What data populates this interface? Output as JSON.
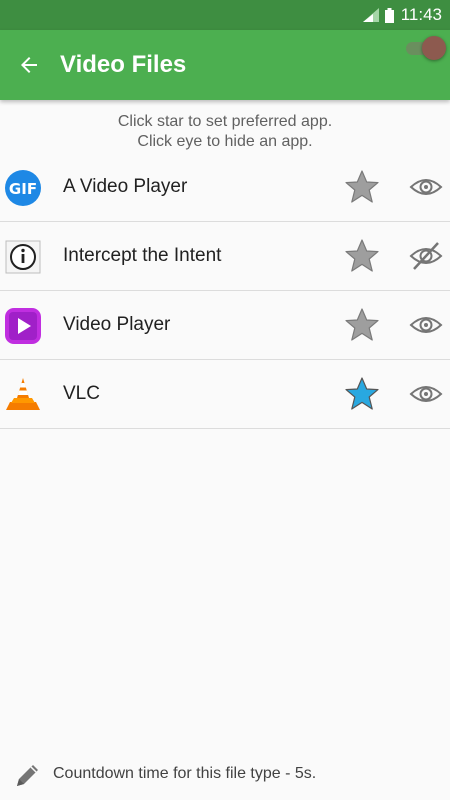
{
  "status_bar": {
    "time": "11:43"
  },
  "app_bar": {
    "title": "Video Files"
  },
  "hint": {
    "line1": "Click star to set preferred app.",
    "line2": "Click eye to hide an app."
  },
  "apps": [
    {
      "name": "A Video Player",
      "icon": "gif-player-icon",
      "preferred": false,
      "hidden": false
    },
    {
      "name": "Intercept the Intent",
      "icon": "info-icon",
      "preferred": false,
      "hidden": true
    },
    {
      "name": "Video Player",
      "icon": "video-player-icon",
      "preferred": false,
      "hidden": false
    },
    {
      "name": "VLC",
      "icon": "vlc-cone-icon",
      "preferred": true,
      "hidden": false
    }
  ],
  "footer": {
    "text": "Countdown time for this file type - 5s."
  },
  "colors": {
    "status_bar": "#3e8e41",
    "app_bar": "#4caf50",
    "star_default": "#9e9e9e",
    "star_selected": "#29a8e0"
  }
}
